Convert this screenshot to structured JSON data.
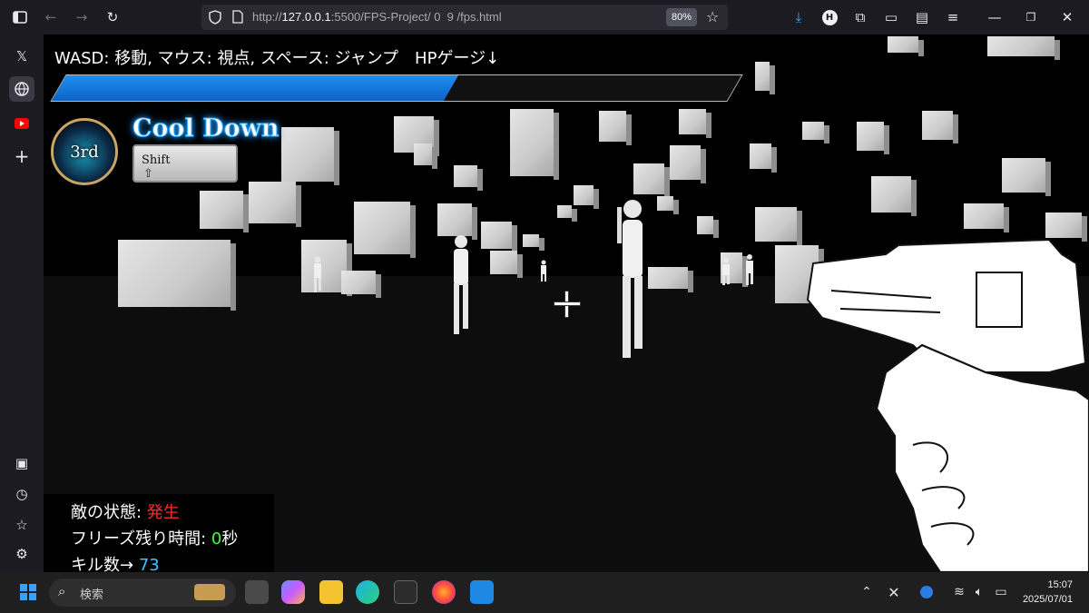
{
  "browser": {
    "url_prefix": "http://",
    "url_host": "127.0.0.1",
    "url_rest": ":5500/FPS-Project/ 0  9 /fps.html",
    "zoom": "80%",
    "extension_badge": "H"
  },
  "sidebar": {
    "x_icon": "𝕏"
  },
  "game": {
    "instructions": "WASD: 移動, マウス: 視点, スペース: ジャンプ　HPゲージ↓",
    "hp_fraction": 0.58,
    "emblem_label": "3rd",
    "cooldown_title": "Cool Down",
    "key_label": "Shift",
    "status": {
      "enemy_state_label": "敵の状態: ",
      "enemy_state_value": "発生",
      "freeze_label": "フリーズ残り時間: ",
      "freeze_value": "0",
      "freeze_unit": "秒",
      "kills_label": "キル数→ ",
      "kills_value": "73"
    }
  },
  "taskbar": {
    "search_placeholder": "検索",
    "time": "15:07",
    "date": "2025/07/01"
  },
  "colors": {
    "hp_fill": "#1f8ff0",
    "enemy_state": "#ff2a2a",
    "freeze_value": "#3dff3d",
    "kills_value": "#35c8ff"
  }
}
